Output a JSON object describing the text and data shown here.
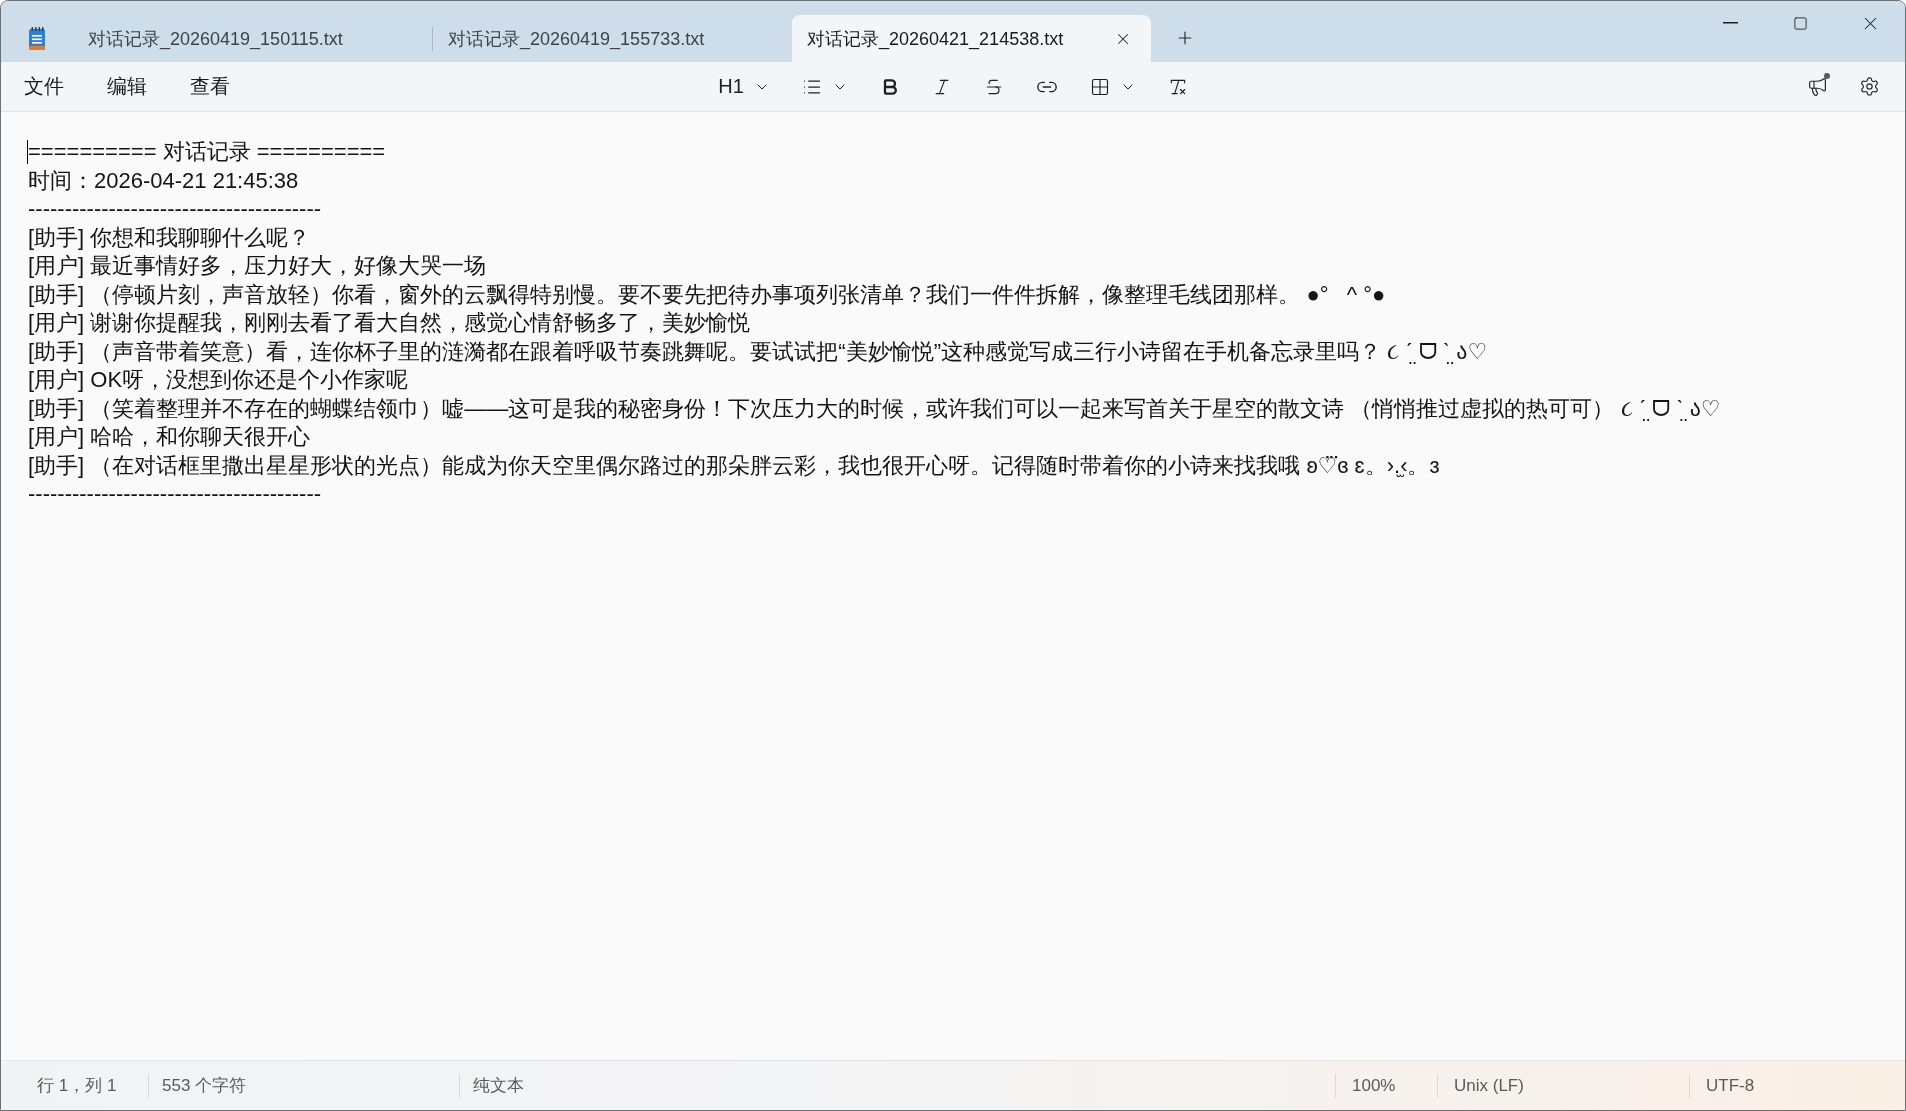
{
  "tabs": [
    {
      "title": "对话记录_20260419_150115.txt",
      "selected": false
    },
    {
      "title": "对话记录_20260419_155733.txt",
      "selected": false
    },
    {
      "title": "对话记录_20260421_214538.txt",
      "selected": true
    }
  ],
  "menu": [
    "文件",
    "编辑",
    "查看"
  ],
  "toolbar": {
    "heading": "H1"
  },
  "document": {
    "lines": [
      "========== 对话记录 ==========",
      "时间：2026-04-21 21:45:38",
      "----------------------------------------",
      "[助手] 你想和我聊聊什么呢？",
      "[用户] 最近事情好多，压力好大，好像大哭一场",
      "[助手] （停顿片刻，声音放轻）你看，窗外的云飘得特别慢。要不要先把待办事项列张清单？我们一件件拆解，像整理毛线团那样。 ●°   ^ °●",
      "[用户] 谢谢你提醒我，刚刚去看了看大自然，感觉心情舒畅多了，美妙愉悦",
      "[助手] （声音带着笑意）看，连你杯子里的涟漪都在跟着呼吸节奏跳舞呢。要试试把“美妙愉悦”这种感觉写成三行小诗留在手机备忘录里吗？ ૮ ˊ̤ ᗜ ˋ̤ ა♡",
      "[用户] OK呀，没想到你还是个小作家呢",
      "[助手] （笑着整理并不存在的蝴蝶结领巾）嘘——这可是我的秘密身份！下次压力大的时候，或许我们可以一起来写首关于星空的散文诗 （悄悄推过虚拟的热可可） ૮ ˊ̤ ᗜ ˋ̤ ა♡",
      "[用户] 哈哈，和你聊天很开心",
      "[助手] （在对话框里撒出星星形状的光点）能成为你天空里偶尔路过的那朵胖云彩，我也很开心呀。记得随时带着你的小诗来找我哦 ʚ♡⃛ɞ ɛ。›.̫‹。ɜ",
      "----------------------------------------"
    ]
  },
  "status_bar": {
    "position": "行 1，列 1",
    "characters": "553 个字符",
    "format": "纯文本",
    "zoom": "100%",
    "line_ending": "Unix (LF)",
    "encoding": "UTF-8"
  }
}
